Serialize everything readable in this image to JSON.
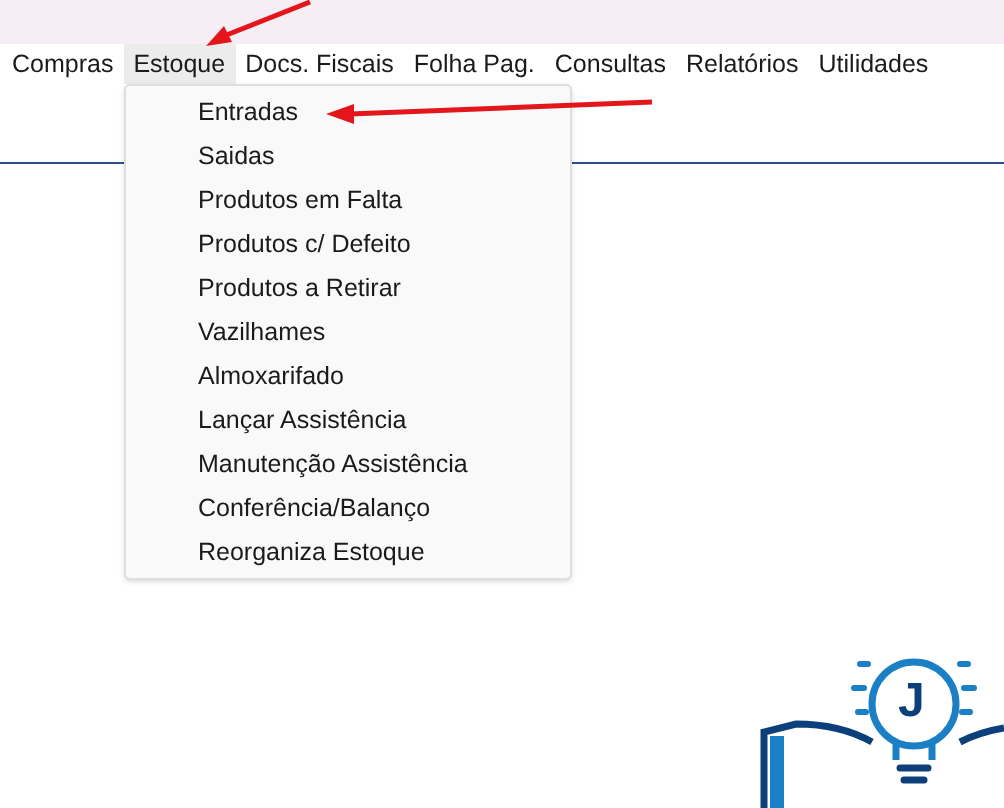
{
  "menu_bar": [
    {
      "label": "Compras",
      "selected": false
    },
    {
      "label": "Estoque",
      "selected": true
    },
    {
      "label": "Docs. Fiscais",
      "selected": false
    },
    {
      "label": "Folha Pag.",
      "selected": false
    },
    {
      "label": "Consultas",
      "selected": false
    },
    {
      "label": "Relatórios",
      "selected": false
    },
    {
      "label": "Utilidades",
      "selected": false
    }
  ],
  "dropdown": {
    "items": [
      {
        "label": "Entradas"
      },
      {
        "label": "Saidas"
      },
      {
        "label": "Produtos em Falta"
      },
      {
        "label": "Produtos c/ Defeito"
      },
      {
        "label": "Produtos a Retirar"
      },
      {
        "label": "Vazilhames"
      },
      {
        "label": "Almoxarifado"
      },
      {
        "label": "Lançar Assistência"
      },
      {
        "label": "Manutenção Assistência"
      },
      {
        "label": "Conferência/Balanço"
      },
      {
        "label": "Reorganiza Estoque"
      }
    ]
  },
  "logo": {
    "letter": "J"
  }
}
